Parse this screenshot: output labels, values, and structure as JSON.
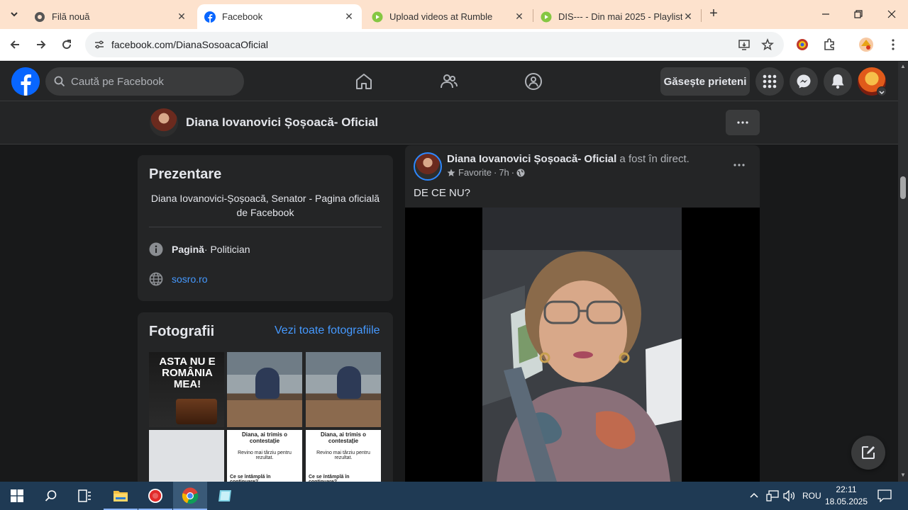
{
  "browser": {
    "tabs": [
      {
        "label": "Filă nouă",
        "icon": "chrome-icon",
        "active": false
      },
      {
        "label": "Facebook",
        "icon": "facebook-icon",
        "active": true
      },
      {
        "label": "Upload videos at Rumble",
        "icon": "rumble-icon",
        "active": false
      },
      {
        "label": "DIS--- - Din mai 2025 - Playlist",
        "icon": "rumble-icon",
        "active": false
      }
    ],
    "url": "facebook.com/DianaSosoacaOficial"
  },
  "fb": {
    "search_placeholder": "Caută pe Facebook",
    "find_friends": "Găsește prieteni",
    "brand_color": "#0866ff"
  },
  "page": {
    "name": "Diana Iovanovici Șoșoacă- Oficial"
  },
  "intro": {
    "title": "Prezentare",
    "bio": "Diana Iovanovici-Șoșoacă, Senator - Pagina oficială de Facebook",
    "category_bold": "Pagină",
    "category_rest": " · Politician",
    "website": "sosro.ro"
  },
  "photos": {
    "title": "Fotografii",
    "see_all": "Vezi toate fotografiile",
    "tile1_text": "ASTA NU E ROMÂNIA MEA!",
    "tile_doc_title": "Diana, ai trimis o contestație",
    "tile_doc_sub": "Revino mai târziu pentru rezultat.",
    "tile_doc_section": "Ce se întâmplă în continuare?"
  },
  "post": {
    "author": "Diana Iovanovici Șoșoacă- Oficial",
    "action": " a fost în direct.",
    "meta_favorite": "Favorite",
    "meta_time": "7h",
    "text": "DE CE NU?"
  },
  "taskbar": {
    "language": "ROU",
    "time": "22:11",
    "date": "18.05.2025"
  }
}
